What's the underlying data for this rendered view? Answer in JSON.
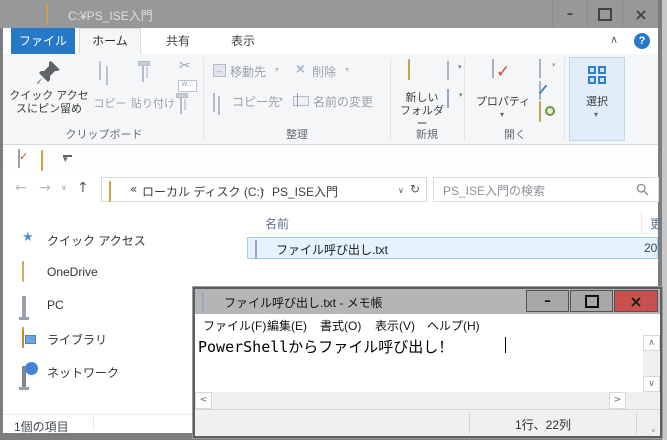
{
  "icons": {
    "minimize": "–",
    "close": "×",
    "scissors": "✂",
    "copy_path_label": "W…",
    "back_arrow": "←",
    "forward_arrow": "→",
    "up_arrow": "↑",
    "refresh": "↻",
    "chevron_down": "∨",
    "chevron_up": "∧",
    "dropdown": "▾",
    "delete_x": "×",
    "quick_access_star": "★",
    "help": "?",
    "guillemet": "«",
    "breadcrumb_sep": "›",
    "scroll_up": "∧",
    "scroll_down": "∨",
    "scroll_left": "<",
    "scroll_right": ">"
  },
  "explorer": {
    "titlebar": {
      "title": "C:¥PS_ISE入門"
    },
    "tabs": {
      "file": "ファイル",
      "home": "ホーム",
      "share": "共有",
      "view": "表示"
    },
    "ribbon": {
      "pin_line1": "クイック アクセ",
      "pin_line2": "スにピン留め",
      "copy": "コピー",
      "paste": "貼り付け",
      "move_to": "移動先",
      "copy_to": "コピー先",
      "delete": "削除",
      "rename": "名前の変更",
      "new_folder_line1": "新しい",
      "new_folder_line2": "フォルダー",
      "properties": "プロパティ",
      "select": "選択",
      "group_clipboard": "クリップボード",
      "group_organize": "整理",
      "group_new": "新規",
      "group_open": "開く"
    },
    "addressbar": {
      "crumb_root": "ローカル ディスク (C:)",
      "crumb_current": "PS_ISE入門",
      "search_placeholder": "PS_ISE入門の検索"
    },
    "sidebar": {
      "quick_access": "クイック アクセス",
      "onedrive": "OneDrive",
      "pc": "PC",
      "libraries": "ライブラリ",
      "network": "ネットワーク"
    },
    "filelist": {
      "col_name": "名前",
      "col_modified_truncated": "更",
      "file_name": "ファイル呼び出し.txt",
      "file_modified_truncated": "20"
    },
    "statusbar": {
      "items_count": "1個の項目"
    }
  },
  "notepad": {
    "title": "ファイル呼び出し.txt - メモ帳",
    "menu": {
      "file": "ファイル(F)",
      "edit": "編集(E)",
      "format": "書式(O)",
      "view": "表示(V)",
      "help": "ヘルプ(H)"
    },
    "content": "PowerShellからファイル呼び出し！",
    "status_position": "1行、22列"
  },
  "colors": {
    "accent_blue": "#2878c8",
    "titlebar_gray": "#96989a",
    "selection_bg": "#e5f3ff",
    "selection_border": "#9fd1f7",
    "notepad_close_red": "#c9504e"
  }
}
